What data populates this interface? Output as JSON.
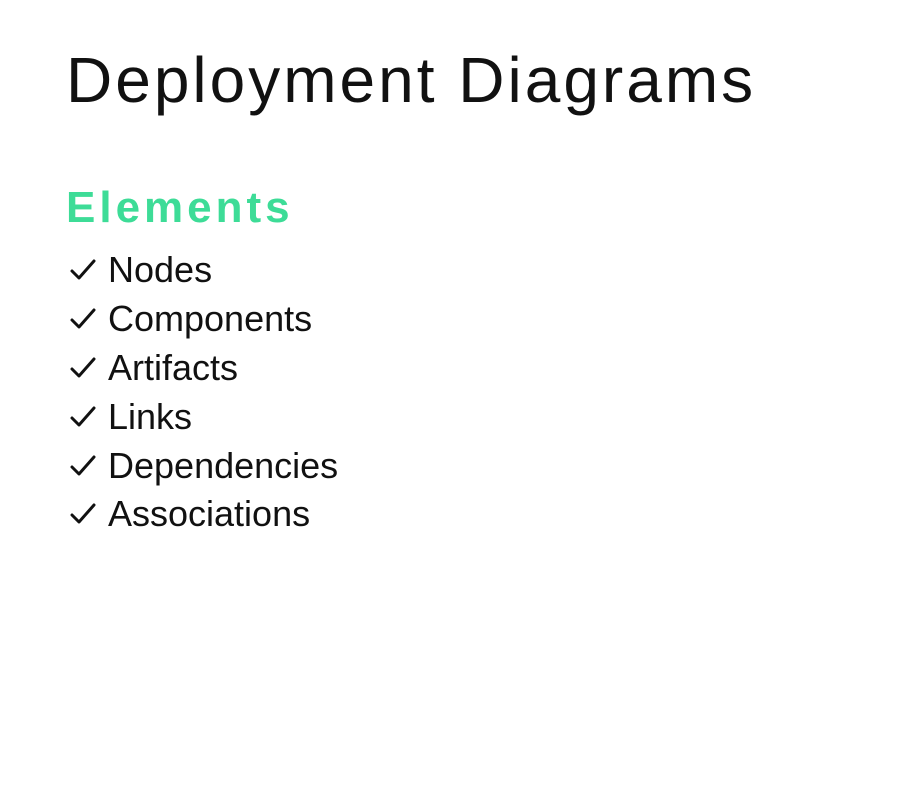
{
  "title": "Deployment Diagrams",
  "section": {
    "heading": "Elements",
    "accent_color": "#3ddc97",
    "items": [
      {
        "icon": "check-icon",
        "label": "Nodes"
      },
      {
        "icon": "check-icon",
        "label": "Components"
      },
      {
        "icon": "check-icon",
        "label": "Artifacts"
      },
      {
        "icon": "check-icon",
        "label": "Links"
      },
      {
        "icon": "check-icon",
        "label": "Dependencies"
      },
      {
        "icon": "check-icon",
        "label": "Associations"
      }
    ]
  }
}
